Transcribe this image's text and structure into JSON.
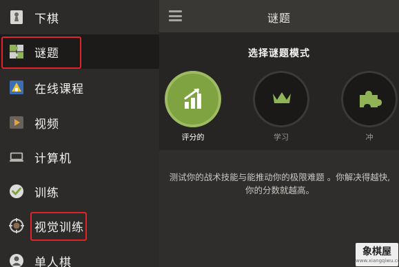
{
  "sidebar": {
    "items": [
      {
        "label": "下棋",
        "icon": "pawn-icon"
      },
      {
        "label": "谜题",
        "icon": "puzzle-icon",
        "active": true
      },
      {
        "label": "在线课程",
        "icon": "lesson-icon"
      },
      {
        "label": "视频",
        "icon": "video-icon"
      },
      {
        "label": "计算机",
        "icon": "computer-icon"
      },
      {
        "label": "训练",
        "icon": "check-icon"
      },
      {
        "label": "视觉训练",
        "icon": "target-icon"
      },
      {
        "label": "单人棋",
        "icon": "person-icon"
      }
    ]
  },
  "header": {
    "title": "谜题"
  },
  "puzzles": {
    "heading": "选择谜题模式",
    "modes": [
      {
        "label": "评分的",
        "icon": "rated-chart-icon",
        "selected": true
      },
      {
        "label": "学习",
        "icon": "crown-icon"
      },
      {
        "label": "冲",
        "icon": "puzzle-piece-icon"
      }
    ],
    "description": "测试你的战术技能与能推动你的极限难题 。你解决得越快,你的分数就越高。"
  },
  "watermark": {
    "main": "象棋屋",
    "sub": "www.xiangqiwu.com"
  },
  "colors": {
    "accent_green": "#7fa341",
    "highlight_red": "#e0242a",
    "sidebar_bg": "#2c2b29",
    "active_bg": "#1c1b1a"
  }
}
